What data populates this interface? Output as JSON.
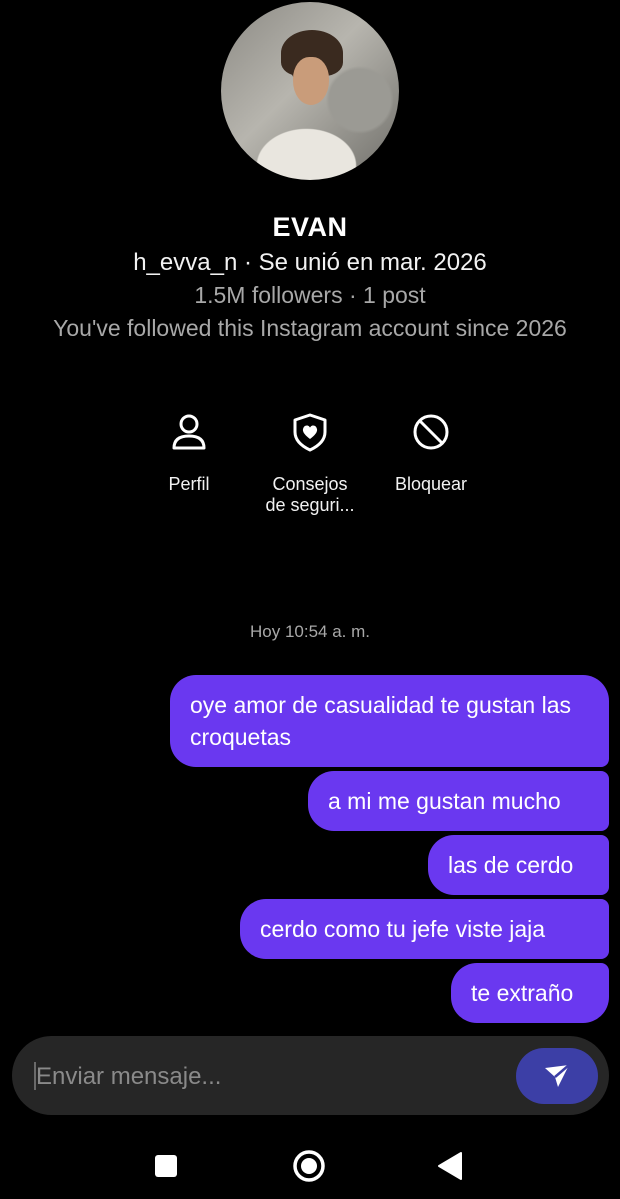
{
  "profile": {
    "name": "EVAN",
    "handle_line": "h_evva_n · Se unió en mar. 2026",
    "followers_line": "1.5M followers · 1 post",
    "follow_since": "You've followed this Instagram account since 2026"
  },
  "actions": [
    {
      "label": "Perfil",
      "icon": "person-icon"
    },
    {
      "label": "Consejos de seguri...",
      "icon": "shield-heart-icon"
    },
    {
      "label": "Bloquear",
      "icon": "block-icon"
    }
  ],
  "chat": {
    "timestamp": "Hoy 10:54 a. m.",
    "messages": [
      "oye amor de casualidad te gustan las croquetas",
      "a mi me gustan mucho",
      "las de cerdo",
      "cerdo como tu jefe viste jaja",
      "te extraño"
    ]
  },
  "composer": {
    "placeholder": "Enviar mensaje...",
    "send_icon": "send-icon"
  },
  "colors": {
    "background": "#000000",
    "bubble": "#6a38f0",
    "send_button": "#3c3fa6",
    "composer": "#262626"
  }
}
